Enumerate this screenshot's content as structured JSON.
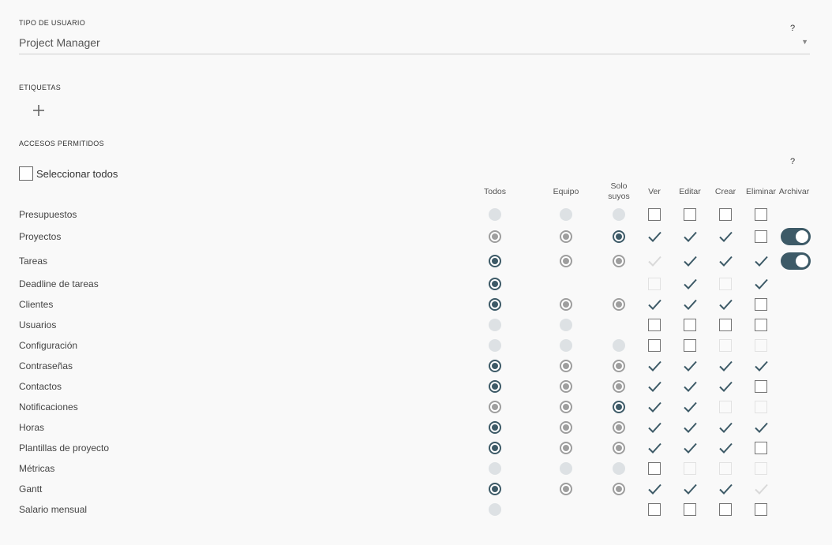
{
  "user_type": {
    "label": "TIPO DE USUARIO",
    "help": "?",
    "value": "Project Manager",
    "arrow_icon": "caret-down-icon"
  },
  "tags": {
    "label": "ETIQUETAS",
    "add_icon": "plus-icon"
  },
  "access": {
    "label": "ACCESOS PERMITIDOS",
    "help": "?",
    "select_all_label": "Seleccionar todos",
    "columns": {
      "todos": "Todos",
      "equipo": "Equipo",
      "solo_suyos_line1": "Solo",
      "solo_suyos_line2": "suyos",
      "ver": "Ver",
      "editar": "Editar",
      "crear": "Crear",
      "eliminar": "Eliminar",
      "archivar": "Archivar"
    },
    "state_legend": {
      "radio": "active = selected, gray = available, disabled = unavailable, none = not shown",
      "checkbox": "checked, checked-disabled, empty, empty-disabled, none"
    },
    "rows": [
      {
        "label": "Presupuestos",
        "scope": [
          "disabled",
          "disabled",
          "disabled"
        ],
        "perms": [
          "empty",
          "empty",
          "empty",
          "empty"
        ],
        "archive": false
      },
      {
        "label": "Proyectos",
        "scope": [
          "gray",
          "gray",
          "active"
        ],
        "perms": [
          "checked",
          "checked",
          "checked",
          "empty"
        ],
        "archive": true
      },
      {
        "label": "Tareas",
        "scope": [
          "active",
          "gray",
          "gray"
        ],
        "perms": [
          "checked-disabled",
          "checked",
          "checked",
          "checked"
        ],
        "archive": true
      },
      {
        "label": "Deadline de tareas",
        "scope": [
          "active",
          "none",
          "none"
        ],
        "perms": [
          "empty-disabled",
          "checked",
          "empty-disabled",
          "checked"
        ],
        "archive": false
      },
      {
        "label": "Clientes",
        "scope": [
          "active",
          "gray",
          "gray"
        ],
        "perms": [
          "checked",
          "checked",
          "checked",
          "empty"
        ],
        "archive": false
      },
      {
        "label": "Usuarios",
        "scope": [
          "disabled",
          "disabled",
          "none"
        ],
        "perms": [
          "empty",
          "empty",
          "empty",
          "empty"
        ],
        "archive": false
      },
      {
        "label": "Configuración",
        "scope": [
          "disabled",
          "disabled",
          "disabled"
        ],
        "perms": [
          "empty",
          "empty",
          "empty-disabled",
          "empty-disabled"
        ],
        "archive": false
      },
      {
        "label": "Contraseñas",
        "scope": [
          "active",
          "gray",
          "gray"
        ],
        "perms": [
          "checked",
          "checked",
          "checked",
          "checked"
        ],
        "archive": false
      },
      {
        "label": "Contactos",
        "scope": [
          "active",
          "gray",
          "gray"
        ],
        "perms": [
          "checked",
          "checked",
          "checked",
          "empty"
        ],
        "archive": false
      },
      {
        "label": "Notificaciones",
        "scope": [
          "gray",
          "gray",
          "active"
        ],
        "perms": [
          "checked",
          "checked",
          "empty-disabled",
          "empty-disabled"
        ],
        "archive": false
      },
      {
        "label": "Horas",
        "scope": [
          "active",
          "gray",
          "gray"
        ],
        "perms": [
          "checked",
          "checked",
          "checked",
          "checked"
        ],
        "archive": false
      },
      {
        "label": "Plantillas de proyecto",
        "scope": [
          "active",
          "gray",
          "gray"
        ],
        "perms": [
          "checked",
          "checked",
          "checked",
          "empty"
        ],
        "archive": false
      },
      {
        "label": "Métricas",
        "scope": [
          "disabled",
          "disabled",
          "disabled"
        ],
        "perms": [
          "empty",
          "empty-disabled",
          "empty-disabled",
          "empty-disabled"
        ],
        "archive": false
      },
      {
        "label": "Gantt",
        "scope": [
          "active",
          "gray",
          "gray"
        ],
        "perms": [
          "checked",
          "checked",
          "checked",
          "checked-disabled"
        ],
        "archive": false
      },
      {
        "label": "Salario mensual",
        "scope": [
          "disabled",
          "none",
          "none"
        ],
        "perms": [
          "empty",
          "empty",
          "empty",
          "empty"
        ],
        "archive": false
      }
    ]
  },
  "colors": {
    "accent": "#3d5a67",
    "radio_gray": "#9e9e9e",
    "disabled": "#dde1e4",
    "background": "#f9f9f9"
  }
}
